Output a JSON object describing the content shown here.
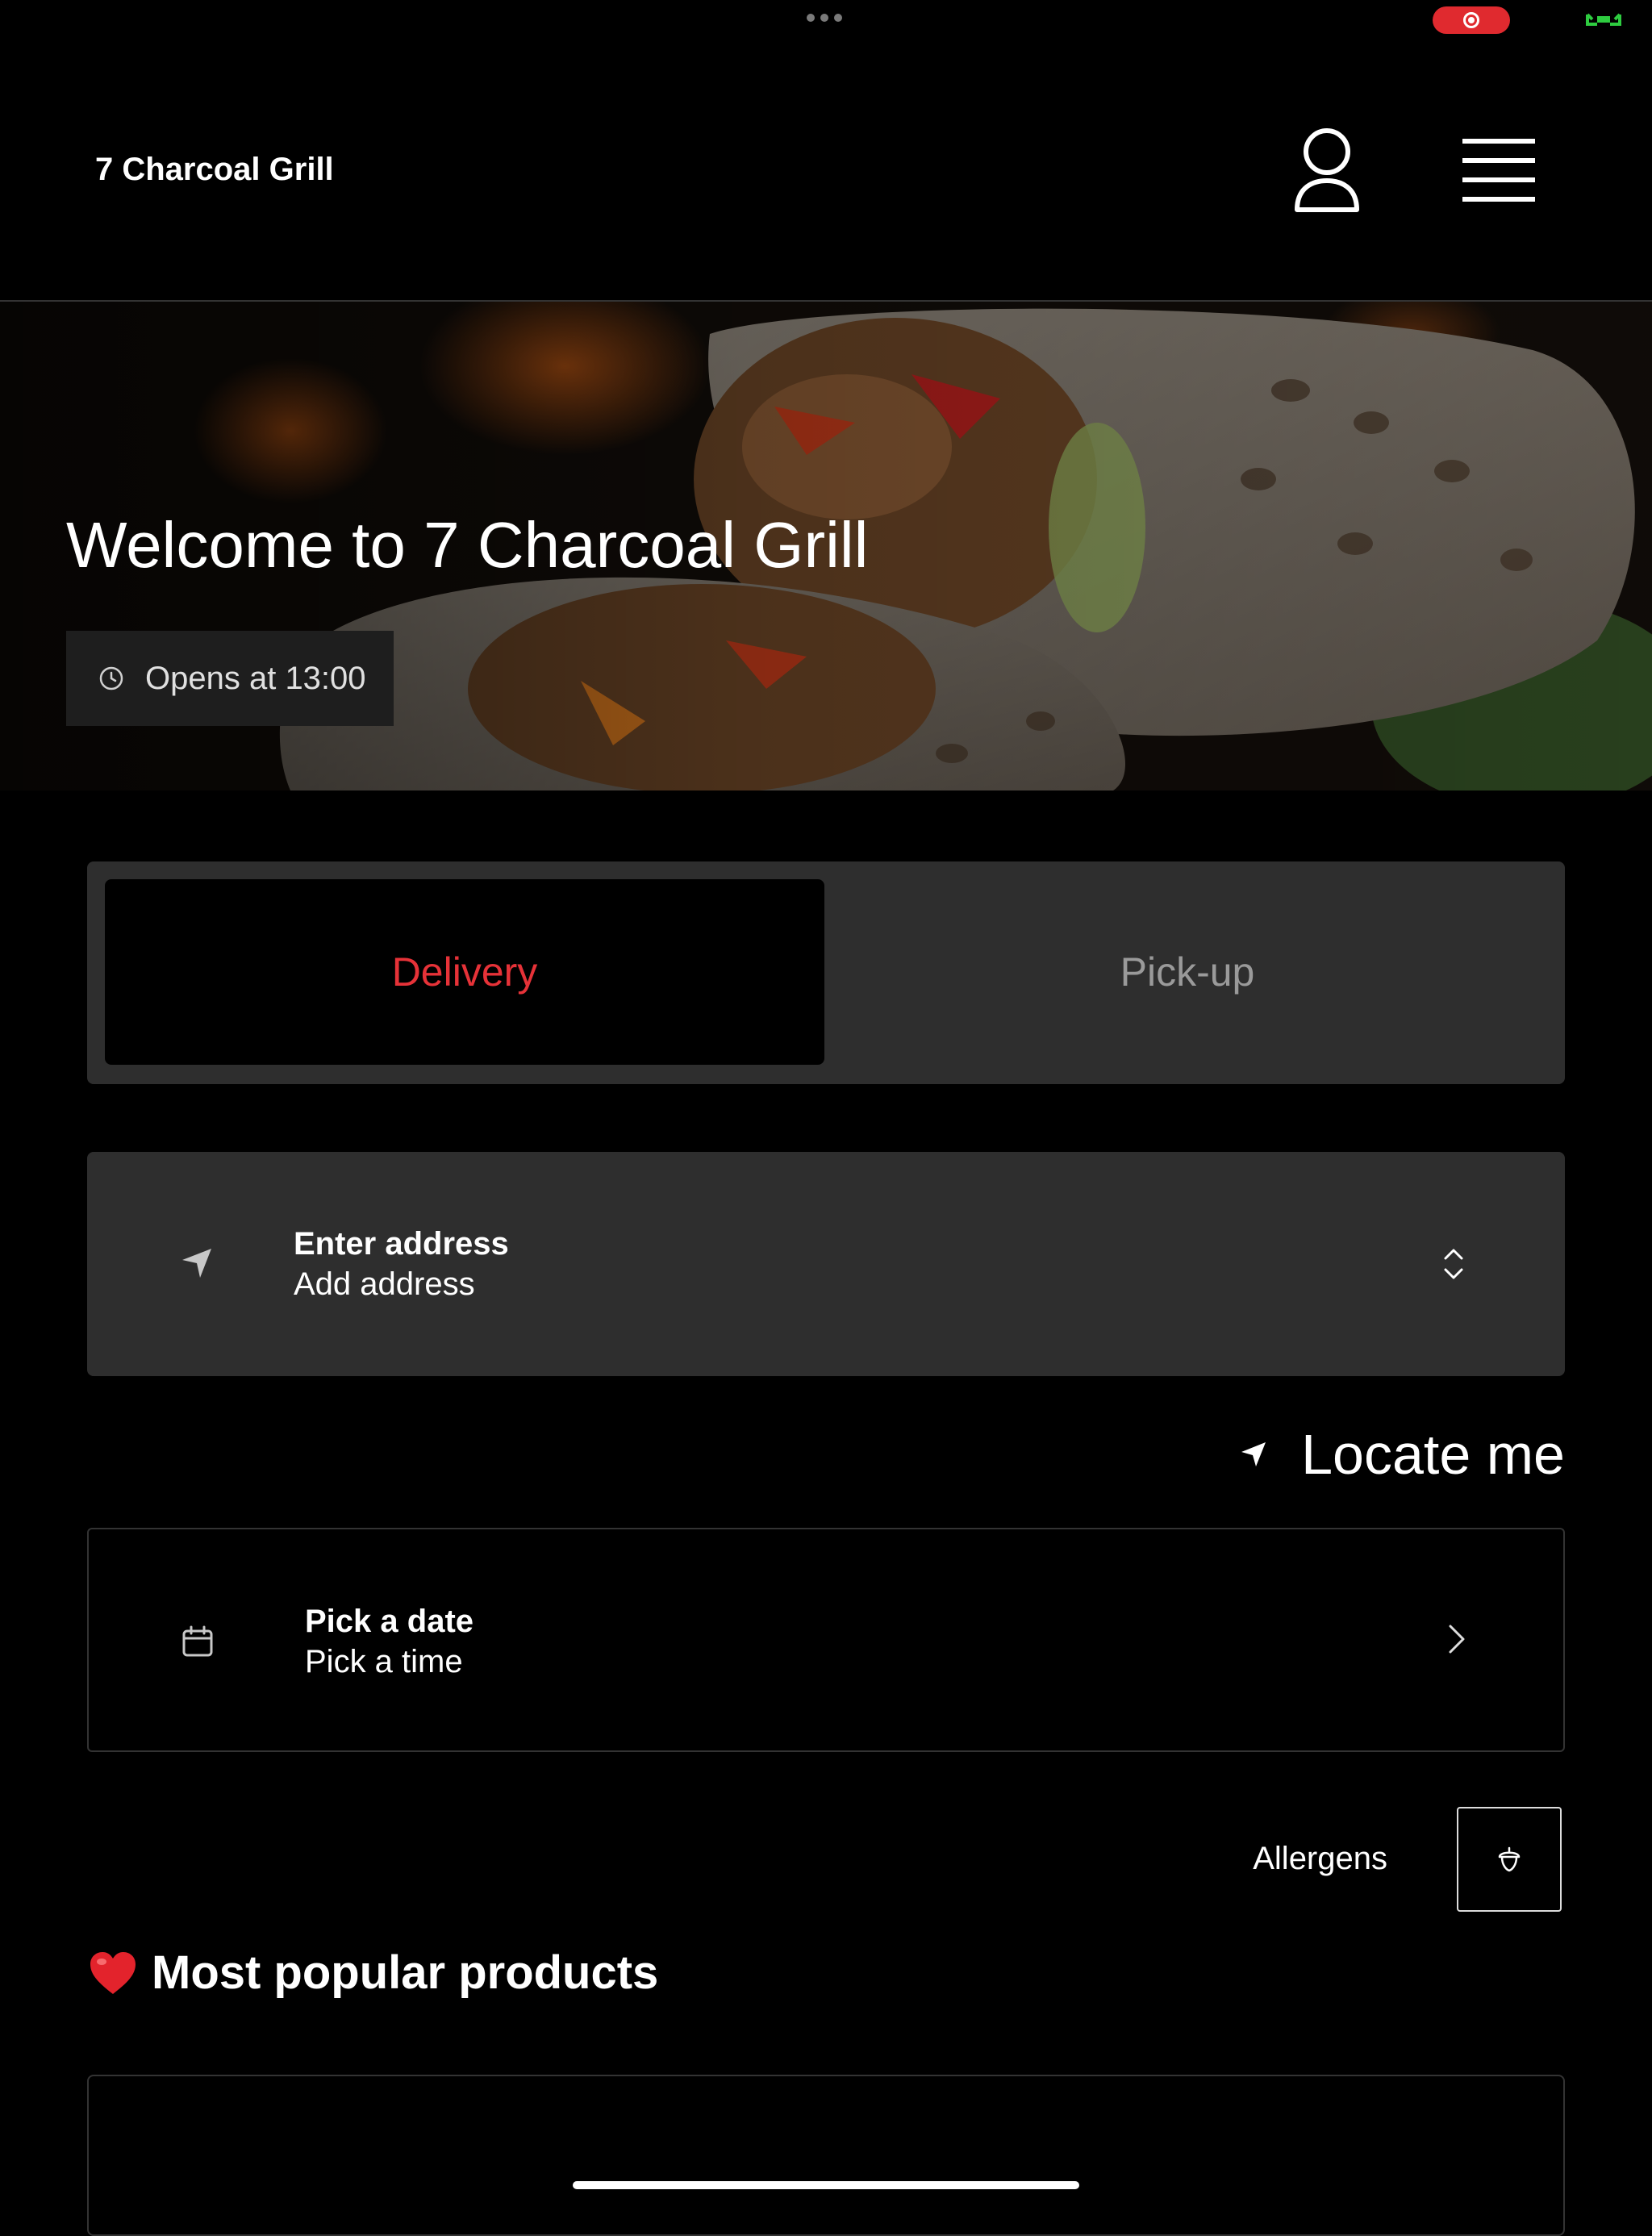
{
  "status_bar": {
    "more_icon": "ellipsis-icon",
    "recording_icon": "screen-record-icon",
    "battery_icon": "battery-icon",
    "recording_color": "#e02a2f",
    "battery_color": "#2ecc40"
  },
  "header": {
    "brand": "7 Charcoal Grill",
    "profile_icon": "user-icon",
    "menu_icon": "hamburger-menu-icon"
  },
  "hero": {
    "title": "Welcome to 7 Charcoal Grill",
    "hours_icon": "clock-icon",
    "hours": "Opens at 13:00",
    "image": "chicken-wrap-photo"
  },
  "fulfillment": {
    "options": [
      {
        "label": "Delivery",
        "active": true
      },
      {
        "label": "Pick-up",
        "active": false
      }
    ],
    "active_color": "#e63238"
  },
  "address": {
    "icon": "navigation-arrow-icon",
    "title": "Enter address",
    "subtitle": "Add address",
    "expand_icon": "chevron-up-down-icon"
  },
  "locate": {
    "icon": "location-arrow-icon",
    "label": "Locate me"
  },
  "schedule": {
    "icon": "calendar-icon",
    "title": "Pick a date",
    "subtitle": "Pick a time",
    "arrow_icon": "chevron-right-icon"
  },
  "allergens": {
    "label": "Allergens",
    "icon": "acorn-icon"
  },
  "popular": {
    "emoji": "heart-icon",
    "title": "Most popular products"
  }
}
